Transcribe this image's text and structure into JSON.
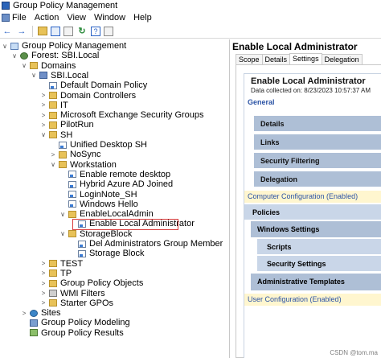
{
  "window": {
    "title": "Group Policy Management"
  },
  "menu": [
    "File",
    "Action",
    "View",
    "Window",
    "Help"
  ],
  "toolbar": [
    "back-arrow-icon",
    "forward-arrow-icon",
    "up-folder-icon",
    "show-pane-icon",
    "refresh-icon",
    "help-icon",
    "properties-icon"
  ],
  "tree": [
    {
      "label": "Group Policy Management",
      "icon": "gpm",
      "level": 0,
      "exp": "v"
    },
    {
      "label": "Forest: SBI.Local",
      "icon": "forest",
      "level": 1,
      "exp": "v"
    },
    {
      "label": "Domains",
      "icon": "folder",
      "level": 2,
      "exp": "v"
    },
    {
      "label": "SBI.Local",
      "icon": "domain",
      "level": 3,
      "exp": "v"
    },
    {
      "label": "Default Domain Policy",
      "icon": "gpo",
      "level": 4,
      "exp": ""
    },
    {
      "label": "Domain Controllers",
      "icon": "folder",
      "level": 4,
      "exp": ">"
    },
    {
      "label": "IT",
      "icon": "folder",
      "level": 4,
      "exp": ">"
    },
    {
      "label": "Microsoft Exchange Security Groups",
      "icon": "folder",
      "level": 4,
      "exp": ">"
    },
    {
      "label": "PilotRun",
      "icon": "folder",
      "level": 4,
      "exp": ">"
    },
    {
      "label": "SH",
      "icon": "folder",
      "level": 4,
      "exp": "v"
    },
    {
      "label": "Unified Desktop SH",
      "icon": "gpo",
      "level": 5,
      "exp": ""
    },
    {
      "label": "NoSync",
      "icon": "folder",
      "level": 5,
      "exp": ">"
    },
    {
      "label": "Workstation",
      "icon": "folder",
      "level": 5,
      "exp": "v"
    },
    {
      "label": "Enable remote desktop",
      "icon": "gpo",
      "level": 6,
      "exp": ""
    },
    {
      "label": "Hybrid Azure AD Joined",
      "icon": "gpo",
      "level": 6,
      "exp": ""
    },
    {
      "label": "LoginNote_SH",
      "icon": "gpo",
      "level": 6,
      "exp": ""
    },
    {
      "label": "Windows Hello",
      "icon": "gpo",
      "level": 6,
      "exp": ""
    },
    {
      "label": "EnableLocalAdmin",
      "icon": "folder",
      "level": 6,
      "exp": "v"
    },
    {
      "label": "Enable Local Administrator",
      "icon": "gpo",
      "level": 7,
      "exp": ""
    },
    {
      "label": "StorageBlock",
      "icon": "folder",
      "level": 6,
      "exp": "v"
    },
    {
      "label": "Del Administrators Group Member",
      "icon": "gpo",
      "level": 7,
      "exp": ""
    },
    {
      "label": "Storage Block",
      "icon": "gpo",
      "level": 7,
      "exp": ""
    },
    {
      "label": "TEST",
      "icon": "folder",
      "level": 4,
      "exp": ">"
    },
    {
      "label": "TP",
      "icon": "folder",
      "level": 4,
      "exp": ">"
    },
    {
      "label": "Group Policy Objects",
      "icon": "folder",
      "level": 4,
      "exp": ">"
    },
    {
      "label": "WMI Filters",
      "icon": "wmi",
      "level": 4,
      "exp": ">"
    },
    {
      "label": "Starter GPOs",
      "icon": "starter",
      "level": 4,
      "exp": ">"
    },
    {
      "label": "Sites",
      "icon": "sites",
      "level": 2,
      "exp": ">"
    },
    {
      "label": "Group Policy Modeling",
      "icon": "model",
      "level": 2,
      "exp": ""
    },
    {
      "label": "Group Policy Results",
      "icon": "result",
      "level": 2,
      "exp": ""
    }
  ],
  "right": {
    "header": "Enable Local Administrator",
    "tabs": [
      "Scope",
      "Details",
      "Settings",
      "Delegation"
    ],
    "active_tab": "Settings",
    "report": {
      "title": "Enable Local Administrator",
      "date": "Data collected on: 8/23/2023 10:57:37 AM",
      "general": "General",
      "general_sections": [
        "Details",
        "Links",
        "Security Filtering",
        "Delegation"
      ],
      "computer_config": "Computer Configuration (Enabled)",
      "policies": "Policies",
      "windows_settings": "Windows Settings",
      "scripts": "Scripts",
      "security_settings": "Security Settings",
      "admin_templates": "Administrative Templates",
      "user_config": "User Configuration (Enabled)"
    }
  },
  "watermark": "CSDN @tom.ma"
}
